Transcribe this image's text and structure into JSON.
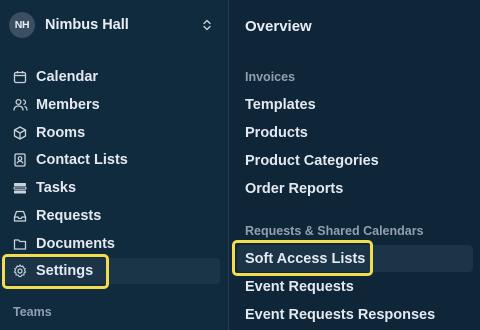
{
  "workspace": {
    "initials": "NH",
    "name": "Nimbus Hall",
    "switch_icon": "chevron-up-down-icon"
  },
  "sidebar": {
    "items": [
      {
        "label": "Calendar",
        "icon": "calendar-icon"
      },
      {
        "label": "Members",
        "icon": "users-icon"
      },
      {
        "label": "Rooms",
        "icon": "cube-icon"
      },
      {
        "label": "Contact Lists",
        "icon": "contact-book-icon"
      },
      {
        "label": "Tasks",
        "icon": "tasks-icon"
      },
      {
        "label": "Requests",
        "icon": "inbox-icon"
      },
      {
        "label": "Documents",
        "icon": "folder-icon"
      },
      {
        "label": "Settings",
        "icon": "gear-icon",
        "active": true
      }
    ],
    "section_label": "Teams"
  },
  "panel": {
    "title": "Overview",
    "groups": [
      {
        "header": "Invoices",
        "links": [
          "Templates",
          "Products",
          "Product Categories",
          "Order Reports"
        ]
      },
      {
        "header": "Requests & Shared Calendars",
        "links": [
          "Soft Access Lists",
          "Event Requests",
          "Event Requests Responses"
        ]
      }
    ],
    "active_link": "Soft Access Lists"
  },
  "colors": {
    "background": "#102a3e",
    "active_row": "#1c3448",
    "highlight": "#f1dd4e",
    "text": "#e3e9ef",
    "muted_text": "#8fa0b0"
  }
}
